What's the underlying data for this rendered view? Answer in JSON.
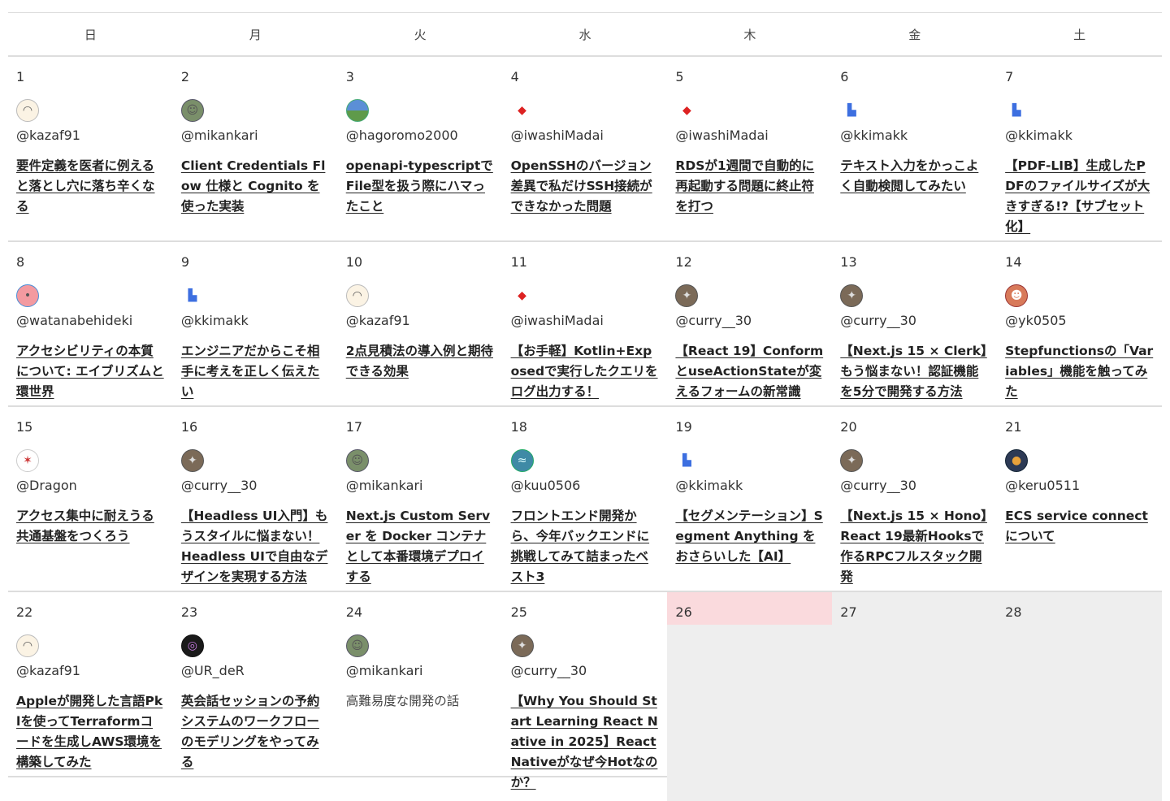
{
  "weekdays": [
    "日",
    "月",
    "火",
    "水",
    "木",
    "金",
    "土"
  ],
  "weeks": [
    [
      {
        "day": "1",
        "user": "@kazaf91",
        "title": "要件定義を医者に例えると落とし穴に落ち辛くなる",
        "avatar": "sheep-avatar-icon"
      },
      {
        "day": "2",
        "user": "@mikankari",
        "title": "Client Credentials Flow 仕様と Cognito を使った実装",
        "avatar": "character-avatar-icon"
      },
      {
        "day": "3",
        "user": "@hagoromo2000",
        "title": "openapi-typescriptでFile型を扱う際にハマったこと",
        "avatar": "landscape-avatar-icon"
      },
      {
        "day": "4",
        "user": "@iwashiMadai",
        "title": "OpenSSHのバージョン差異で私だけSSH接続ができなかった問題",
        "avatar": "fish-avatar-icon"
      },
      {
        "day": "5",
        "user": "@iwashiMadai",
        "title": "RDSが1週間で自動的に再起動する問題に終止符を打つ",
        "avatar": "fish-avatar-icon"
      },
      {
        "day": "6",
        "user": "@kkimakk",
        "title": "テキスト入力をかっこよく自動検閲してみたい",
        "avatar": "castle-avatar-icon"
      },
      {
        "day": "7",
        "user": "@kkimakk",
        "title": "【PDF-LIB】生成したPDFのファイルサイズが大きすぎる!?【サブセット化】",
        "avatar": "castle-avatar-icon"
      }
    ],
    [
      {
        "day": "8",
        "user": "@watanabehideki",
        "title": "アクセシビリティの本質について: エイブリズムと環世界",
        "avatar": "pig-avatar-icon"
      },
      {
        "day": "9",
        "user": "@kkimakk",
        "title": "エンジニアだからこそ相手に考えを正しく伝えたい",
        "avatar": "castle-avatar-icon"
      },
      {
        "day": "10",
        "user": "@kazaf91",
        "title": "2点見積法の導入例と期待できる効果",
        "avatar": "sheep-avatar-icon"
      },
      {
        "day": "11",
        "user": "@iwashiMadai",
        "title": "【お手軽】Kotlin+Exposedで実行したクエリをログ出力する！",
        "avatar": "fish-avatar-icon"
      },
      {
        "day": "12",
        "user": "@curry__30",
        "title": "【React 19】ConformとuseActionStateが変えるフォームの新常識",
        "avatar": "photo-avatar-icon"
      },
      {
        "day": "13",
        "user": "@curry__30",
        "title": "【Next.js 15 × Clerk】もう悩まない！認証機能を5分で開発する方法",
        "avatar": "photo-avatar-icon"
      },
      {
        "day": "14",
        "user": "@yk0505",
        "title": "Stepfunctionsの「Variables」機能を触ってみた",
        "avatar": "person-avatar-icon"
      }
    ],
    [
      {
        "day": "15",
        "user": "@Dragon",
        "title": "アクセス集中に耐えうる共通基盤をつくろう",
        "avatar": "dragon-avatar-icon"
      },
      {
        "day": "16",
        "user": "@curry__30",
        "title": "【Headless UI入門】もうスタイルに悩まない！Headless UIで自由なデザインを実現する方法",
        "avatar": "photo-avatar-icon"
      },
      {
        "day": "17",
        "user": "@mikankari",
        "title": "Next.js Custom Server を Docker コンテナとして本番環境デプロイする",
        "avatar": "character-avatar-icon"
      },
      {
        "day": "18",
        "user": "@kuu0506",
        "title": "フロントエンド開発から、今年バックエンドに挑戦してみて詰まったベスト3",
        "avatar": "wave-avatar-icon"
      },
      {
        "day": "19",
        "user": "@kkimakk",
        "title": "【セグメンテーション】Segment Anything をおさらいした【AI】",
        "avatar": "castle-avatar-icon"
      },
      {
        "day": "20",
        "user": "@curry__30",
        "title": "【Next.js 15 × Hono】React 19最新Hooksで作るRPCフルスタック開発",
        "avatar": "photo-avatar-icon"
      },
      {
        "day": "21",
        "user": "@keru0511",
        "title": "ECS service connectについて",
        "avatar": "night-avatar-icon"
      }
    ],
    [
      {
        "day": "22",
        "user": "@kazaf91",
        "title": "Appleが開発した言語Pklを使ってTerraformコードを生成しAWS環境を構築してみた",
        "avatar": "sheep-avatar-icon"
      },
      {
        "day": "23",
        "user": "@UR_deR",
        "title": "英会話セッションの予約システムのワークフローのモデリングをやってみる",
        "avatar": "circle-avatar-icon"
      },
      {
        "day": "24",
        "user": "@mikankari",
        "title": "高難易度な開発の話",
        "avatar": "character-avatar-icon",
        "plain": true
      },
      {
        "day": "25",
        "user": "@curry__30",
        "title": "【Why You Should Start Learning React Native in 2025】React Nativeがなぜ今Hotなのか？",
        "avatar": "photo-avatar-icon"
      },
      {
        "day": "26",
        "today": true,
        "empty": true
      },
      {
        "day": "27",
        "empty": true
      },
      {
        "day": "28",
        "empty": true
      }
    ]
  ],
  "colors": {
    "today_highlight": "#fadadd",
    "empty_cell": "#eeeeee",
    "border": "#dddddd"
  }
}
